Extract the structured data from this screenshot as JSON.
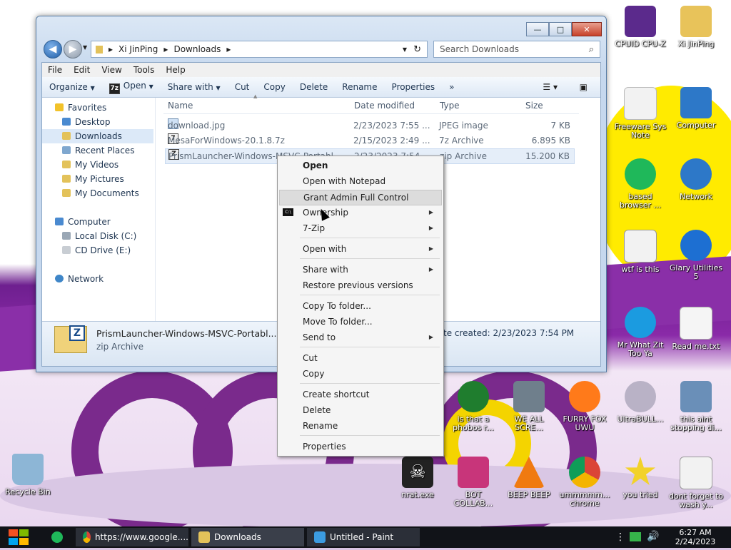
{
  "window": {
    "address": {
      "root": "Xi JinPing",
      "folder": "Downloads"
    },
    "search_placeholder": "Search Downloads",
    "caption": {
      "minimize": "—",
      "maximize": "□",
      "close": "✕"
    }
  },
  "menubar": [
    "File",
    "Edit",
    "View",
    "Tools",
    "Help"
  ],
  "toolbar": [
    "Organize",
    "Open",
    "Share with",
    "Cut",
    "Copy",
    "Delete",
    "Rename",
    "Properties"
  ],
  "toolbar_more": "»",
  "sidebar": {
    "favorites": "Favorites",
    "favorite_items": [
      "Desktop",
      "Downloads",
      "Recent Places",
      "My Videos",
      "My Pictures",
      "My Documents"
    ],
    "computer": "Computer",
    "computer_items": [
      "Local Disk (C:)",
      "CD Drive (E:)"
    ],
    "network": "Network"
  },
  "columns": {
    "name": "Name",
    "date": "Date modified",
    "type": "Type",
    "size": "Size"
  },
  "files": [
    {
      "name": "download.jpg",
      "date": "2/23/2023 7:55 ...",
      "type": "JPEG image",
      "size": "7 KB",
      "icon": "image"
    },
    {
      "name": "MesaForWindows-20.1.8.7z",
      "date": "2/15/2023 2:49 ...",
      "type": "7z Archive",
      "size": "6.895 KB",
      "icon": "7z"
    },
    {
      "name": "PrismLauncher-Windows-MSVC-Portabl...",
      "date": "2/23/2023 7:54 ...",
      "type": "zip Archive",
      "size": "15.200 KB",
      "icon": "zip"
    }
  ],
  "details": {
    "name": "PrismLauncher-Windows-MSVC-Portabl...",
    "type": "zip Archive",
    "created": "te created: 2/23/2023 7:54 PM"
  },
  "context_menu": [
    {
      "label": "Open",
      "bold": true
    },
    {
      "label": "Open with Notepad"
    },
    {
      "label": "Grant Admin Full Control",
      "highlight": true
    },
    {
      "label": "Ownership",
      "submenu": true,
      "icon": "cmd"
    },
    {
      "label": "7-Zip",
      "submenu": true
    },
    {
      "label": "Open with",
      "submenu": true
    },
    {
      "label": "Share with",
      "submenu": true
    },
    {
      "label": "Restore previous versions"
    },
    {
      "label": "Copy To folder..."
    },
    {
      "label": "Move To folder..."
    },
    {
      "label": "Send to",
      "submenu": true
    },
    {
      "label": "Cut"
    },
    {
      "label": "Copy"
    },
    {
      "label": "Create shortcut"
    },
    {
      "label": "Delete"
    },
    {
      "label": "Rename"
    },
    {
      "label": "Properties"
    }
  ],
  "desktop_icons": [
    {
      "label": "CPUID CPU-Z",
      "color": "#5b2a8c"
    },
    {
      "label": "Xi JinPing",
      "color": "#e8c35a"
    },
    {
      "label": "Freeware Sys Note",
      "color": "#f2f2f2"
    },
    {
      "label": "Computer",
      "color": "#2d78c8"
    },
    {
      "label": "based browser ...",
      "color": "#1fb85a"
    },
    {
      "label": "Network",
      "color": "#2d78c8"
    },
    {
      "label": "wtf is this",
      "color": "#f2f2f2"
    },
    {
      "label": "Glary Utilities 5",
      "color": "#1d6fd2"
    },
    {
      "label": "Mr What Zit Too Ya",
      "color": "#1b9be0"
    },
    {
      "label": "Read me.txt",
      "color": "#f5f5f5"
    },
    {
      "label": "is that a phobos r...",
      "color": "#1f7d2e"
    },
    {
      "label": "WE ALL SCRE...",
      "color": "#6f7f8c"
    },
    {
      "label": "FURRY FOX UWU",
      "color": "#ff7a1a"
    },
    {
      "label": "UltraBULL...",
      "color": "#b9b2c6"
    },
    {
      "label": "this aint stopping di...",
      "color": "#6a8fb8"
    },
    {
      "label": "Recycle Bin",
      "color": "#8db6d6"
    },
    {
      "label": "nrat.exe",
      "color": "#222222"
    },
    {
      "label": "BOT COLLAB...",
      "color": "#c8357a"
    },
    {
      "label": "BEEP BEEP",
      "color": "#f07a10"
    },
    {
      "label": "ummmmm... chrome",
      "color": "#db4437"
    },
    {
      "label": "you tried",
      "color": "#f2d22a"
    },
    {
      "label": "dont forget to wash y...",
      "color": "#f2f2f2"
    }
  ],
  "taskbar": {
    "tasks": [
      "https://www.google....",
      "Downloads",
      "Untitled - Paint"
    ],
    "time": "6:27 AM",
    "date": "2/24/2023"
  }
}
